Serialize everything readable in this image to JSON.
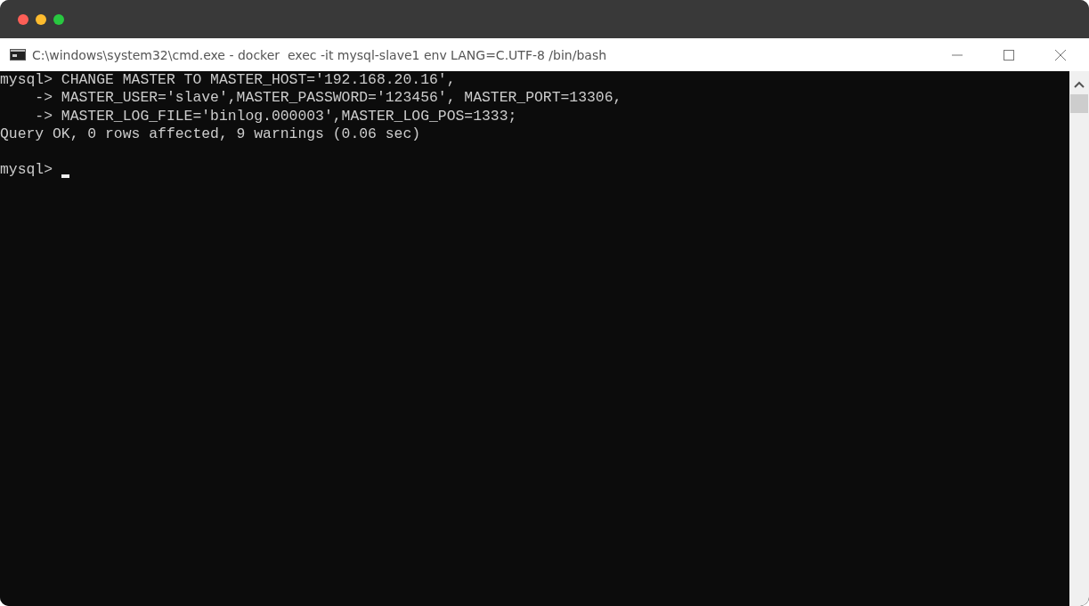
{
  "window": {
    "title": "C:\\windows\\system32\\cmd.exe - docker  exec -it mysql-slave1 env LANG=C.UTF-8 /bin/bash"
  },
  "terminal": {
    "lines": [
      "mysql> CHANGE MASTER TO MASTER_HOST='192.168.20.16',",
      "    -> MASTER_USER='slave',MASTER_PASSWORD='123456', MASTER_PORT=13306,",
      "    -> MASTER_LOG_FILE='binlog.000003',MASTER_LOG_POS=1333;",
      "Query OK, 0 rows affected, 9 warnings (0.06 sec)"
    ],
    "prompt": "mysql> "
  }
}
